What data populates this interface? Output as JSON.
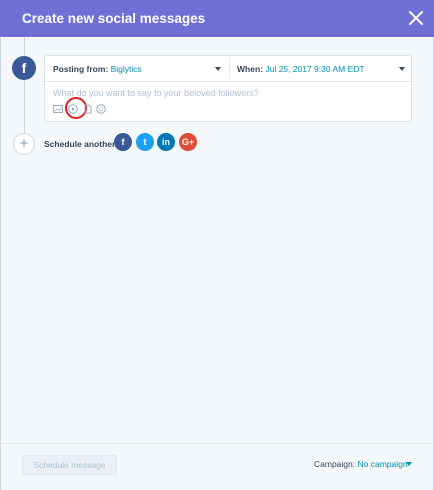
{
  "header": {
    "title": "Create new social messages",
    "close_icon": "close-icon",
    "background": "#6f6fd6"
  },
  "message": {
    "network_icon": "facebook-icon",
    "network_glyph": "f",
    "posting_label": "Posting from:",
    "posting_value": "Biglytics",
    "when_label": "When:",
    "when_value": "Jul 25, 2017 9:30 AM EDT",
    "placeholder": "What do you want to say to your beloved followers?",
    "toolbar_icons": [
      "image-icon",
      "video-play-icon",
      "file-icon",
      "emoji-icon"
    ]
  },
  "schedule_another": {
    "label": "Schedule another:",
    "add_glyph": "+",
    "networks": [
      {
        "name": "facebook",
        "glyph": "f",
        "color": "#3b5998"
      },
      {
        "name": "twitter",
        "glyph": "t",
        "color": "#1da1f2"
      },
      {
        "name": "linkedin",
        "glyph": "in",
        "color": "#0077b5"
      },
      {
        "name": "google-plus",
        "glyph": "G+",
        "color": "#dd4b39"
      }
    ]
  },
  "footer": {
    "schedule_button": "Schedule message",
    "campaign_label": "Campaign:",
    "campaign_value": "No campaign"
  }
}
